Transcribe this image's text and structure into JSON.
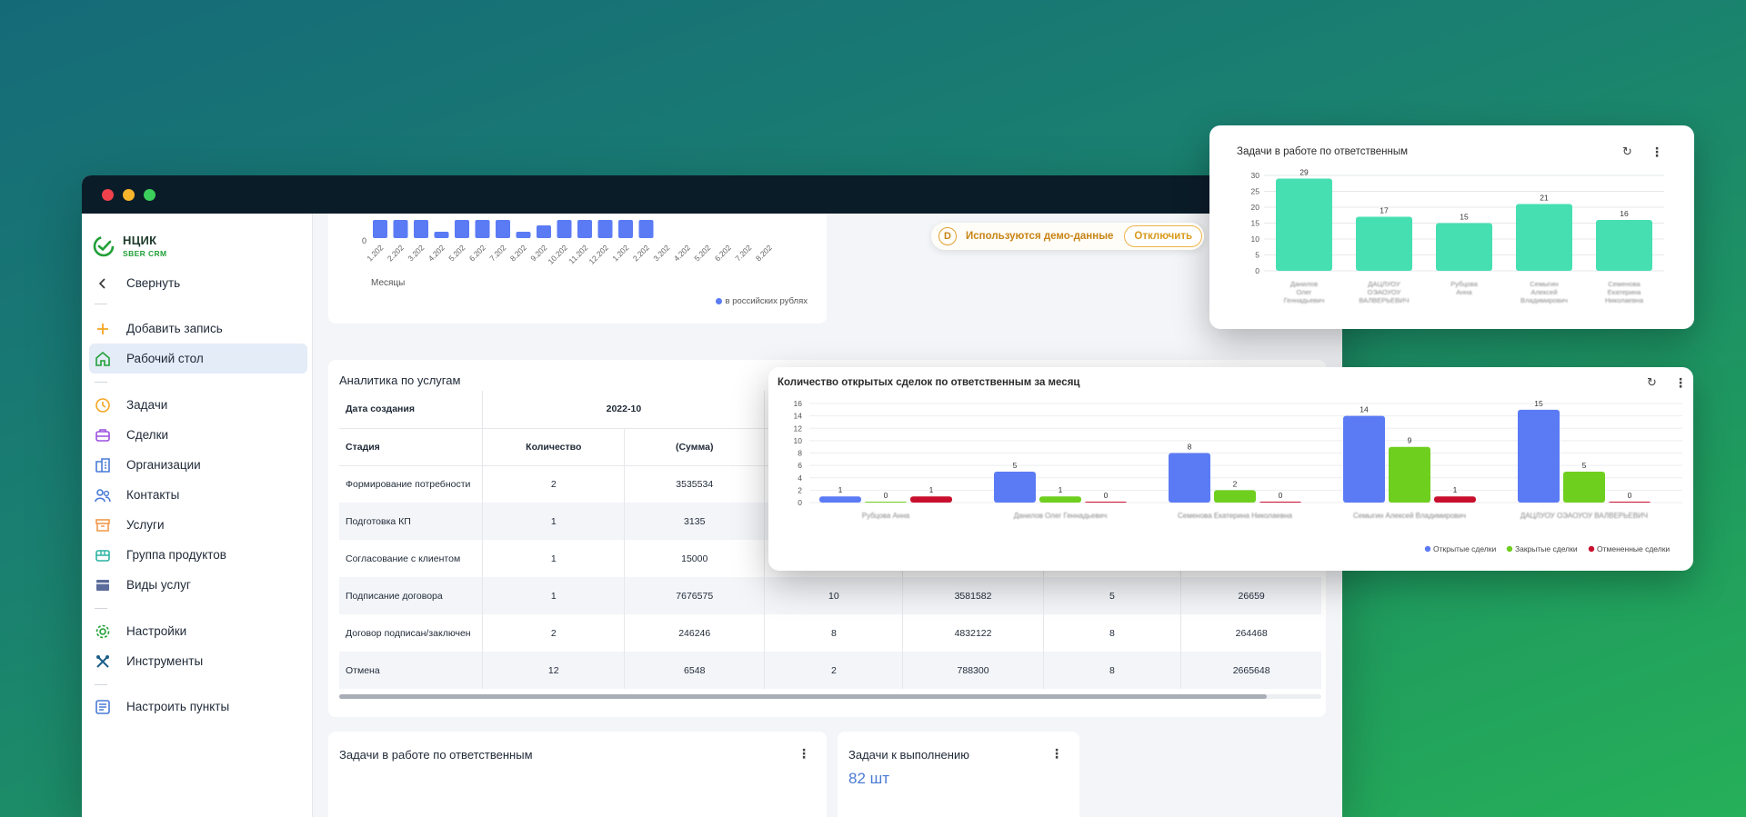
{
  "brand": {
    "title": "НЦИК",
    "subtitle": "SBER CRM"
  },
  "sidebar": {
    "collapse": "Свернуть",
    "items": [
      {
        "label": "Добавить запись",
        "icon": "plus-icon"
      },
      {
        "label": "Рабочий стол",
        "icon": "home-icon",
        "active": true
      },
      {
        "label": "Задачи",
        "icon": "clock-icon"
      },
      {
        "label": "Сделки",
        "icon": "briefcase-icon"
      },
      {
        "label": "Организации",
        "icon": "building-icon"
      },
      {
        "label": "Контакты",
        "icon": "contacts-icon"
      },
      {
        "label": "Услуги",
        "icon": "archive-icon"
      },
      {
        "label": "Группа продуктов",
        "icon": "product-group-icon"
      },
      {
        "label": "Виды услуг",
        "icon": "service-types-icon"
      },
      {
        "label": "Настройки",
        "icon": "gear-icon"
      },
      {
        "label": "Инструменты",
        "icon": "tools-icon"
      },
      {
        "label": "Настроить пункты",
        "icon": "customize-icon"
      }
    ]
  },
  "demo_banner": {
    "text": "Используются демо-данные",
    "button": "Отключить",
    "badge": "D"
  },
  "monthly_chart": {
    "y_tick": "0",
    "xlabel": "Месяцы",
    "legend": "в российских рублях",
    "ticks": [
      "1.202",
      "2.202",
      "3.202",
      "4.202",
      "5.202",
      "6.202",
      "7.202",
      "8.202",
      "9.202",
      "10.202",
      "11.202",
      "12.202",
      "1.202",
      "2.202",
      "3.202",
      "4.202",
      "5.202",
      "6.202",
      "7.202",
      "8.202"
    ]
  },
  "analytics": {
    "title": "Аналитика по услугам",
    "header_date_label": "Дата создания",
    "header_period": "2022-10",
    "header_stage_label": "Стадия",
    "col_count": "Количество",
    "col_sum": "(Сумма)",
    "rows": [
      {
        "stage": "Формирование потребности",
        "c1": "2",
        "c2": "3535534",
        "c3": "",
        "c4": "",
        "c5": "",
        "c6": ""
      },
      {
        "stage": "Подготовка КП",
        "c1": "1",
        "c2": "3135",
        "c3": "",
        "c4": "",
        "c5": "",
        "c6": ""
      },
      {
        "stage": "Согласование с клиентом",
        "c1": "1",
        "c2": "15000",
        "c3": "",
        "c4": "",
        "c5": "",
        "c6": ""
      },
      {
        "stage": "Подписание договора",
        "c1": "1",
        "c2": "7676575",
        "c3": "10",
        "c4": "3581582",
        "c5": "5",
        "c6": "26659"
      },
      {
        "stage": "Договор подписан/заключен",
        "c1": "2",
        "c2": "246246",
        "c3": "8",
        "c4": "4832122",
        "c5": "8",
        "c6": "264468"
      },
      {
        "stage": "Отмена",
        "c1": "12",
        "c2": "6548",
        "c3": "2",
        "c4": "788300",
        "c5": "8",
        "c6": "2665648"
      }
    ]
  },
  "tasks_card": {
    "title": "Задачи в работе по ответственным"
  },
  "todo_card": {
    "title": "Задачи к выполнению",
    "value": "82 шт"
  },
  "colors": {
    "bar_blue": "#5b7bf5",
    "teal": "#46dfb1",
    "green": "#6fcf1e",
    "red": "#c8102e",
    "brand_green": "#21a038"
  },
  "chart_data": [
    {
      "type": "bar",
      "title": "Задачи в работе по ответственным",
      "categories": [
        "Данилов Олег Геннадьевич",
        "ДАЦЛУОУ ОЭАОУОУ ВАЛВЕРЬЕВИЧ",
        "Рубцова Анна",
        "Семыгин Алексей Владимирович",
        "Семенова Екатерина Николаевна"
      ],
      "values": [
        29,
        17,
        15,
        21,
        16
      ],
      "ylim": [
        0,
        30
      ],
      "yticks": [
        "30",
        "25",
        "20",
        "15",
        "10",
        "5",
        "0"
      ],
      "grid": true
    },
    {
      "type": "bar",
      "title": "Количество открытых сделок по ответственным за месяц",
      "categories": [
        "Рубцова Анна",
        "Данилов Олег Геннадьевич",
        "Семенова Екатерина Николаевна",
        "Семыгин Алексей Владимирович",
        "ДАЦЛУОУ ОЭАОУОУ ВАЛВЕРЬЕВИЧ"
      ],
      "series": [
        {
          "name": "Открытые сделки",
          "values": [
            1,
            5,
            8,
            14,
            15
          ]
        },
        {
          "name": "Закрытые сделки",
          "values": [
            0,
            1,
            2,
            9,
            5
          ]
        },
        {
          "name": "Отмененные сделки",
          "values": [
            1,
            0,
            0,
            1,
            0
          ]
        }
      ],
      "ylim": [
        0,
        16
      ],
      "yticks": [
        "16",
        "14",
        "12",
        "10",
        "8",
        "6",
        "4",
        "2",
        "0"
      ],
      "legend": "bottom-right",
      "grid": true
    }
  ]
}
